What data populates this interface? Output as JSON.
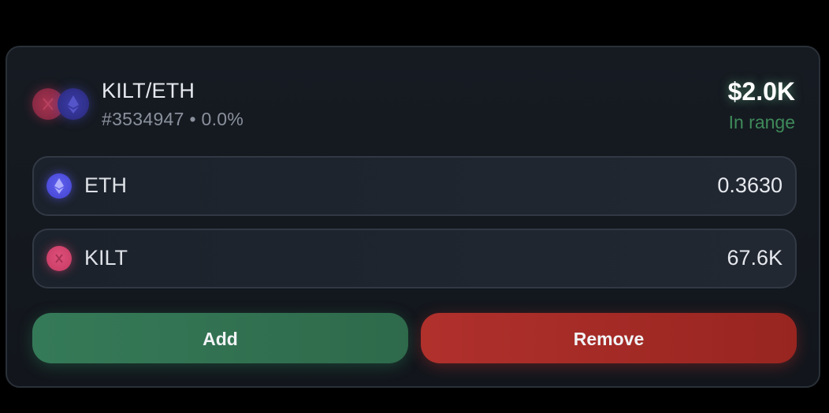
{
  "position": {
    "pair_name": "KILT/ETH",
    "position_id": "#3534947",
    "separator": "•",
    "fee": "0.0%",
    "value": "$2.0K",
    "status": "In range"
  },
  "tokens": [
    {
      "symbol": "ETH",
      "amount": "0.3630",
      "icon": "eth-icon",
      "color": "#4f4fe0"
    },
    {
      "symbol": "KILT",
      "amount": "67.6K",
      "icon": "kilt-icon",
      "color": "#d34470"
    }
  ],
  "actions": {
    "add_label": "Add",
    "remove_label": "Remove"
  },
  "colors": {
    "add": "#357a58",
    "remove": "#b0302c",
    "in_range": "#3f8a5a"
  }
}
